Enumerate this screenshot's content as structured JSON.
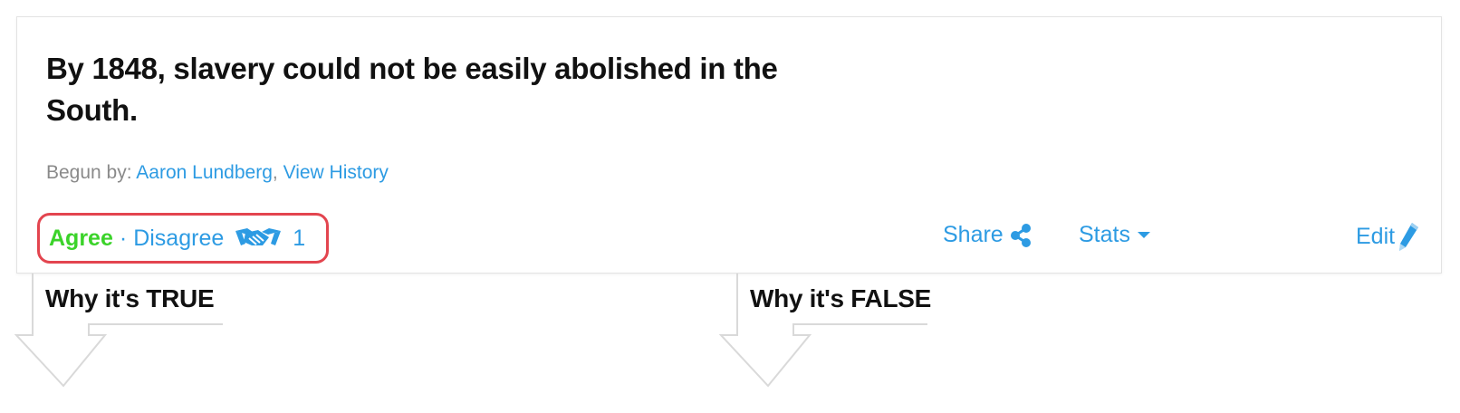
{
  "claim": {
    "title": "By 1848, slavery could not be easily abolished in the South.",
    "begun_by_label": "Begun by:",
    "author": "Aaron Lundberg",
    "separator": ",",
    "view_history": "View History"
  },
  "vote": {
    "agree": "Agree",
    "dot": "·",
    "disagree": "Disagree",
    "agree_count": "1",
    "icon": "handshake-icon"
  },
  "toolbar": {
    "share": "Share",
    "stats": "Stats",
    "edit": "Edit"
  },
  "columns": {
    "true_heading": "Why it's TRUE",
    "false_heading": "Why it's FALSE"
  },
  "colors": {
    "link": "#2d9be3",
    "agree": "#3bd32a",
    "highlight": "#e3454f",
    "arrow": "#d9d9d9"
  }
}
